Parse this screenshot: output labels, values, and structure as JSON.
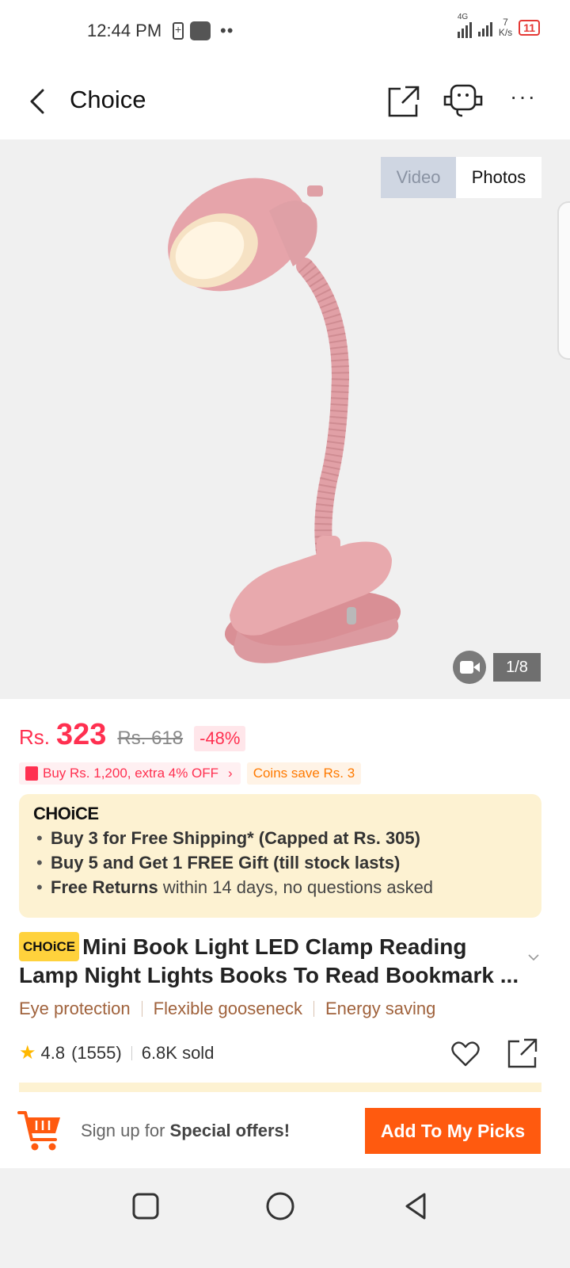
{
  "status_bar": {
    "time": "12:44 PM",
    "network": "4G",
    "speed_value": "7",
    "speed_unit": "K/s",
    "battery": "11"
  },
  "header": {
    "title": "Choice",
    "icons": [
      "back-icon",
      "share-icon",
      "customer-support-icon",
      "more-icon"
    ]
  },
  "gallery": {
    "tabs": [
      "Video",
      "Photos"
    ],
    "active_tab": "Photos",
    "counter": "1/8",
    "image_subject": "pink clip-on gooseneck lamp"
  },
  "price": {
    "currency": "Rs.",
    "current": "323",
    "original": "Rs. 618",
    "discount": "-48%"
  },
  "promos": {
    "bundle": "Buy Rs. 1,200, extra 4% OFF",
    "coins": "Coins save Rs. 3"
  },
  "choice": {
    "logo": "CHOiCE",
    "benefits": [
      {
        "bold": "Buy 3 for  Free Shipping* (Capped at Rs. 305)",
        "rest": ""
      },
      {
        "bold": "Buy 5 and Get 1 FREE Gift (till stock lasts)",
        "rest": ""
      },
      {
        "bold": "Free Returns",
        "rest": " within 14 days, no questions asked"
      }
    ]
  },
  "product": {
    "badge": "CHOiCE",
    "title": "Mini Book Light LED Clamp Reading Lamp Night Lights Books To Read Bookmark ...",
    "features": [
      "Eye protection",
      "Flexible gooseneck",
      "Energy saving"
    ],
    "rating": "4.8",
    "reviews": "(1555)",
    "sold": "6.8K sold"
  },
  "bottom_bar": {
    "signup_prefix": "Sign up for ",
    "signup_bold": "Special offers!",
    "button": "Add To My Picks"
  },
  "colors": {
    "price_red": "#ff3050",
    "accent_orange": "#ff5a0f",
    "choice_yellow": "#ffd23c",
    "choice_bg": "#fdf2d2",
    "feature_brown": "#a0623c",
    "lamp_pink": "#e8a9ad"
  }
}
